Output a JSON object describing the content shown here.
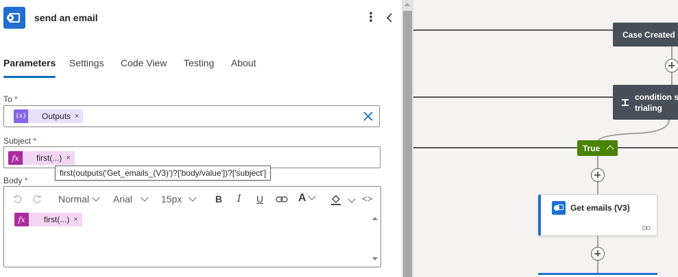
{
  "panel": {
    "title": "send an email",
    "app_icon": "outlook-icon",
    "more_icon": "more-vertical-icon",
    "collapse_icon": "chevron-left-icon"
  },
  "tabs": [
    {
      "label": "Parameters",
      "active": true
    },
    {
      "label": "Settings",
      "active": false
    },
    {
      "label": "Code View",
      "active": false
    },
    {
      "label": "Testing",
      "active": false
    },
    {
      "label": "About",
      "active": false
    }
  ],
  "fields": {
    "to": {
      "label": "To",
      "required_mark": "*",
      "token_label": "Outputs",
      "token_icon": "{x}",
      "token_remove": "×"
    },
    "subject": {
      "label": "Subject",
      "required_mark": "*",
      "token_label": "first(...)",
      "token_icon": "fx",
      "token_remove": "×"
    },
    "body": {
      "label": "Body",
      "required_mark": "*",
      "token_label": "first(...)",
      "token_icon": "fx",
      "token_remove": "×"
    }
  },
  "tooltip": "first(outputs('Get_emails_(V3)')?['body/value'])?['subject']",
  "editor_toolbar": {
    "format": "Normal",
    "font": "Arial",
    "size": "15px",
    "undo_icon": "undo-icon",
    "redo_icon": "redo-icon",
    "bold": "B",
    "italic": "I",
    "underline": "U",
    "link_icon": "link-icon",
    "font_color": "A",
    "fill_icon": "paint-bucket-icon",
    "code_icon": "<>"
  },
  "canvas": {
    "case_created": "Case Created",
    "condition_line1": "condition st",
    "condition_line2": "trialing",
    "true_label": "True",
    "get_emails": "Get emails (V3)"
  },
  "colors": {
    "accent": "#0f6cbd",
    "outlook": "#1e6fd1",
    "variable_token": "#8764e6",
    "expression_token": "#ad2ba0",
    "true_branch": "#498205",
    "dark_node": "#484f58"
  }
}
